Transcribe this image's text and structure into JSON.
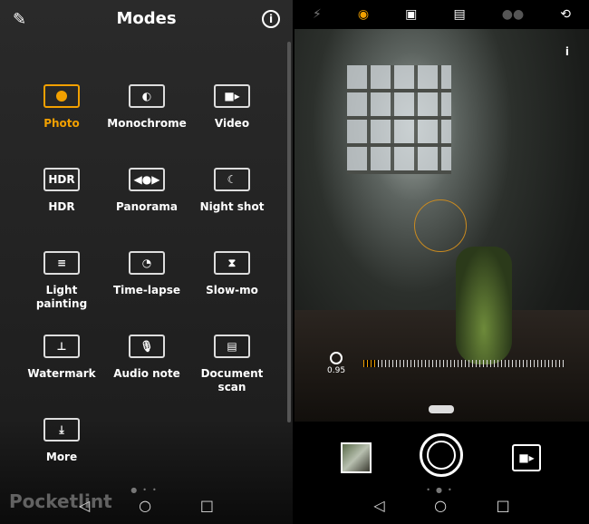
{
  "modes_panel": {
    "title": "Modes",
    "edit_icon": "pencil-icon",
    "info_icon": "i",
    "accent": "#f2a000",
    "items": [
      {
        "label": "Photo",
        "icon": "photo-icon",
        "selected": true
      },
      {
        "label": "Monochrome",
        "icon": "monochrome-icon"
      },
      {
        "label": "Video",
        "icon": "video-icon"
      },
      {
        "label": "HDR",
        "icon": "HDR"
      },
      {
        "label": "Panorama",
        "icon": "panorama-icon"
      },
      {
        "label": "Night shot",
        "icon": "moon-icon"
      },
      {
        "label": "Light painting",
        "icon": "light-trails-icon"
      },
      {
        "label": "Time-lapse",
        "icon": "timelapse-icon"
      },
      {
        "label": "Slow-mo",
        "icon": "hourglass-icon"
      },
      {
        "label": "Watermark",
        "icon": "stamp-icon"
      },
      {
        "label": "Audio note",
        "icon": "microphone-icon"
      },
      {
        "label": "Document scan",
        "icon": "document-icon"
      },
      {
        "label": "More",
        "icon": "download-icon"
      }
    ],
    "watermark_logo": "Pocketlint"
  },
  "camera": {
    "toolbar": [
      "flash-off-icon",
      "aperture-icon",
      "portrait-icon",
      "film-icon",
      "dual-lens-icon",
      "switch-camera-icon"
    ],
    "info_label": "i",
    "aperture_value": "0.95",
    "aperture_slider_level": 0.05
  },
  "nav": {
    "back": "◁",
    "home": "○",
    "recents": "□"
  }
}
